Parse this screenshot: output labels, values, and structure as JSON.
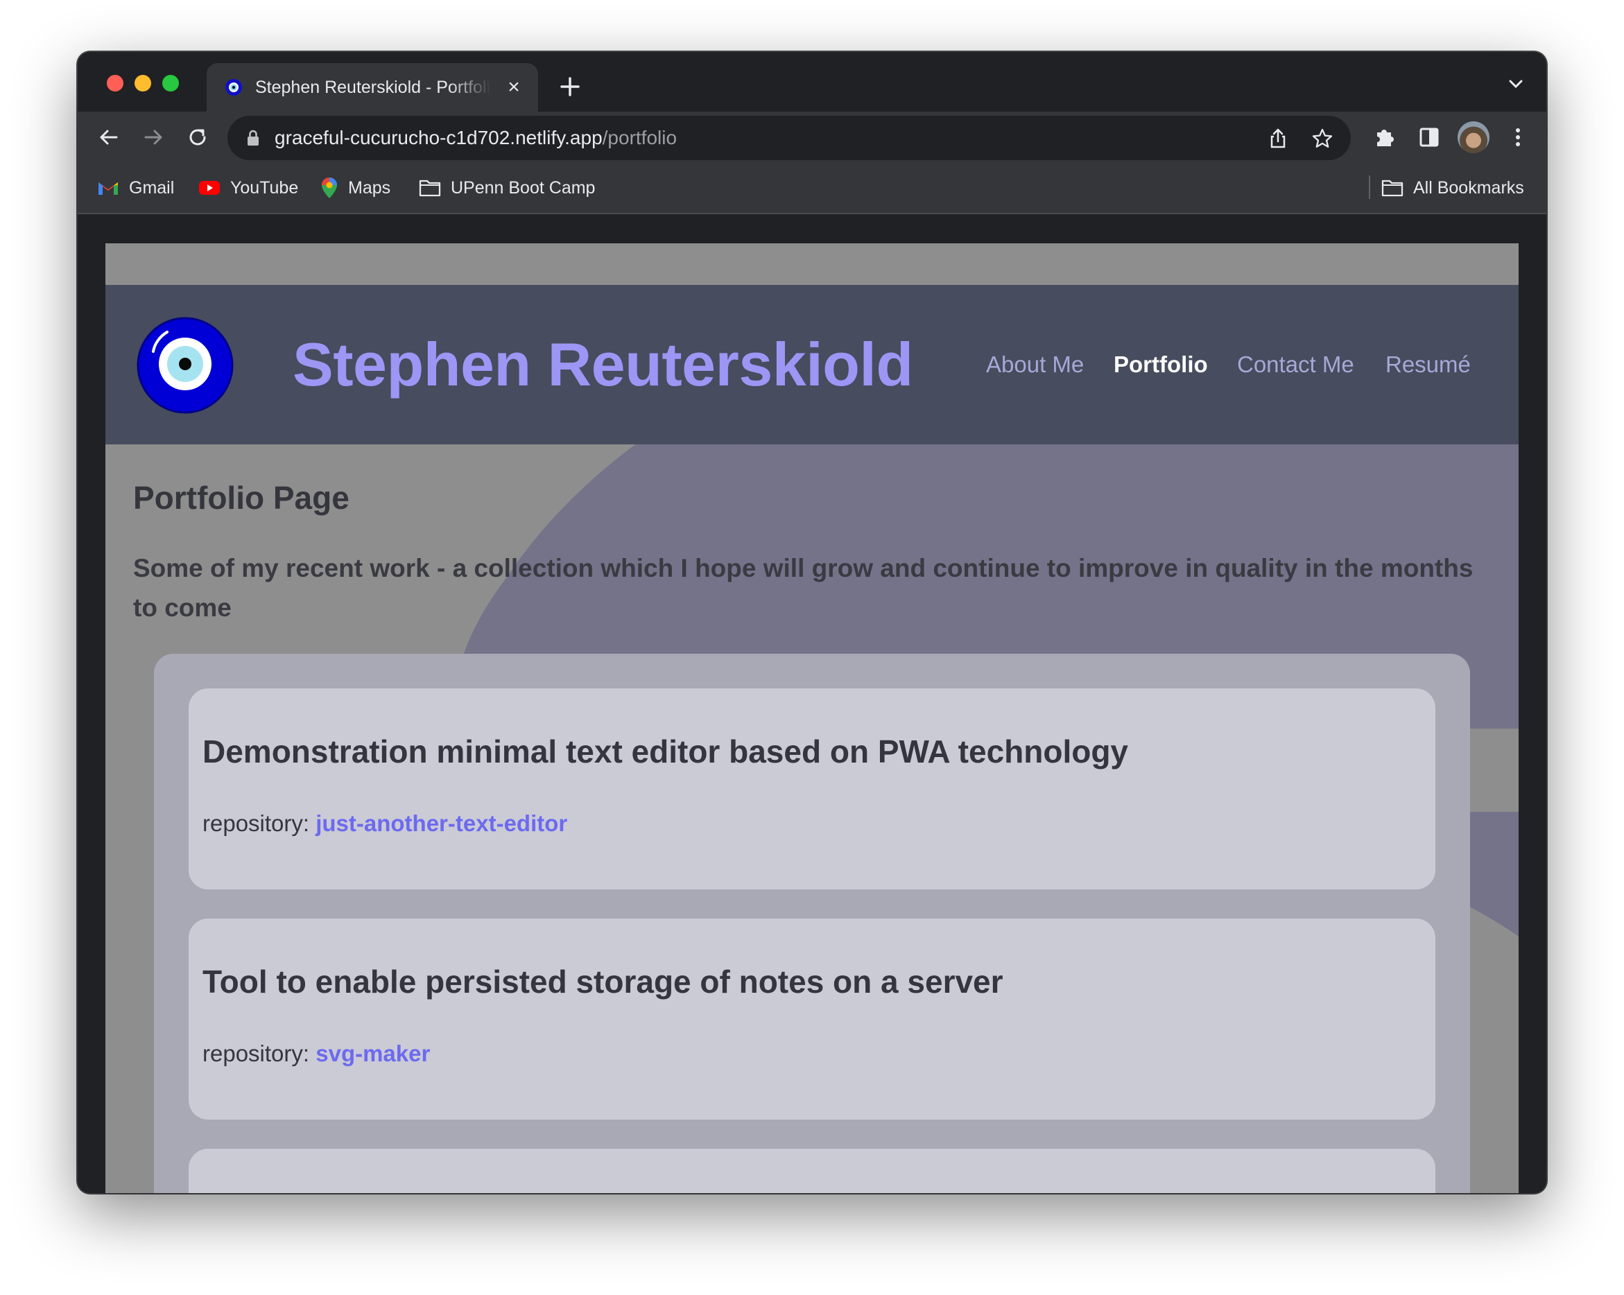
{
  "browser": {
    "tab": {
      "title": "Stephen Reuterskiold - Portfolio"
    },
    "address_bar": {
      "domain": "graceful-cucurucho-c1d702.netlify.app",
      "path": "/portfolio"
    },
    "bookmarks": {
      "items": [
        {
          "label": "Gmail",
          "icon": "gmail-icon"
        },
        {
          "label": "YouTube",
          "icon": "youtube-icon"
        },
        {
          "label": "Maps",
          "icon": "maps-icon"
        },
        {
          "label": "UPenn Boot Camp",
          "icon": "folder-icon"
        }
      ],
      "all_bookmarks": "All Bookmarks"
    }
  },
  "site": {
    "title": "Stephen Reuterskiold",
    "nav": [
      "About Me",
      "Portfolio",
      "Contact Me",
      "Resumé"
    ],
    "active_nav": "Portfolio"
  },
  "page": {
    "heading": "Portfolio Page",
    "intro": "Some of my recent work - a collection which I hope will grow and continue to improve in quality in the months to come"
  },
  "projects": [
    {
      "title": "Demonstration minimal text editor based on PWA technology",
      "repo_label": "repository:",
      "repo_link": "just-another-text-editor"
    },
    {
      "title": "Tool to enable persisted storage of notes on a server",
      "repo_label": "repository:",
      "repo_link": "svg-maker"
    }
  ],
  "colors": {
    "site_title": "#9c96f5",
    "header_bg": "#474c5e",
    "link": "#6c6aef",
    "page_bg": "#8e8e8e"
  }
}
